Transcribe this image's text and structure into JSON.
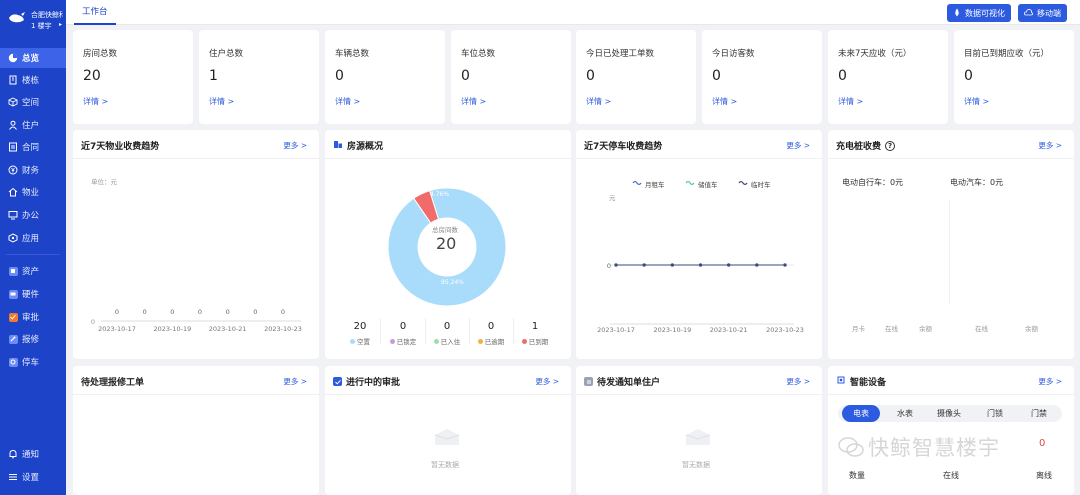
{
  "brand": {
    "company": "合肥快鲸科",
    "building": "1 楼宇",
    "caret": "▸"
  },
  "nav": {
    "overview": "总览",
    "building": "楼栋",
    "space": "空间",
    "resident": "住户",
    "contract": "合同",
    "finance": "财务",
    "property": "物业",
    "office": "办公",
    "apps": "应用",
    "assets": "资产",
    "hardware": "硬件",
    "approval": "审批",
    "repair": "报修",
    "parking": "停车",
    "notify": "通知",
    "settings": "设置"
  },
  "topbar": {
    "tab": "工作台",
    "data_viz": "数据可视化",
    "mobile": "移动端"
  },
  "stats": [
    {
      "title": "房间总数",
      "value": "20",
      "link": "详情 >"
    },
    {
      "title": "住户总数",
      "value": "1",
      "link": "详情 >"
    },
    {
      "title": "车辆总数",
      "value": "0",
      "link": "详情 >"
    },
    {
      "title": "车位总数",
      "value": "0",
      "link": "详情 >"
    },
    {
      "title": "今日已处理工单数",
      "value": "0",
      "link": "详情 >"
    },
    {
      "title": "今日访客数",
      "value": "0",
      "link": "详情 >"
    },
    {
      "title": "未来7天应收（元）",
      "value": "0",
      "link": "详情 >"
    },
    {
      "title": "目前已到期应收（元）",
      "value": "0",
      "link": "详情 >"
    }
  ],
  "panels": {
    "fee_trend": {
      "title": "近7天物业收费趋势",
      "more": "更多 >",
      "unit": "单位：元"
    },
    "housing": {
      "title": "房源概况",
      "center_label": "总房间数",
      "center_value": "20",
      "pct_small": "4.76%",
      "pct_large": "95.24%"
    },
    "parking_trend": {
      "title": "近7天停车收费趋势",
      "more": "更多 >",
      "legend": [
        "月租车",
        "储值车",
        "临时车"
      ],
      "unit_yuan": "元"
    },
    "charging": {
      "title": "充电桩收费",
      "help": "?",
      "more": "更多 >",
      "bike": "电动自行车：0元",
      "car": "电动汽车：0元",
      "axis": [
        "月卡",
        "在线",
        "余额",
        "在线",
        "余额"
      ]
    },
    "repairs": {
      "title": "待处理报修工单",
      "more": "更多 >"
    },
    "approvals": {
      "title": "进行中的审批",
      "more": "更多 >",
      "empty": "暂无数据"
    },
    "notices": {
      "title": "待发通知单住户",
      "more": "更多 >",
      "empty": "暂无数据"
    },
    "devices": {
      "title": "智能设备",
      "more": "更多 >",
      "tabs": [
        "电表",
        "水表",
        "摄像头",
        "门锁",
        "门禁"
      ],
      "cols": [
        "数量",
        "在线",
        "离线"
      ],
      "count": "0"
    }
  },
  "housing_stats": [
    {
      "value": "20",
      "label": "空置",
      "color": "#a9dcfb"
    },
    {
      "value": "0",
      "label": "已锁定",
      "color": "#c79be0"
    },
    {
      "value": "0",
      "label": "已入住",
      "color": "#9be0a8"
    },
    {
      "value": "0",
      "label": "已逾期",
      "color": "#f5b041"
    },
    {
      "value": "1",
      "label": "已到期",
      "color": "#f26b6b"
    }
  ],
  "watermark": "快鲸智慧楼宇",
  "chart_data": [
    {
      "type": "line",
      "title": "近7天物业收费趋势",
      "ylabel": "单位：元",
      "x": [
        "2023-10-17",
        "2023-10-18",
        "2023-10-19",
        "2023-10-20",
        "2023-10-21",
        "2023-10-22",
        "2023-10-23"
      ],
      "x_tick_labels": [
        "2023-10-17",
        "2023-10-19",
        "2023-10-21",
        "2023-10-23"
      ],
      "series": [
        {
          "values": [
            0,
            0,
            0,
            0,
            0,
            0,
            0
          ]
        }
      ],
      "y_tick_labels": [
        "0"
      ]
    },
    {
      "type": "pie",
      "title": "房源概况",
      "labels": [
        "空置",
        "已到期"
      ],
      "values": [
        95.24,
        4.76
      ],
      "colors": [
        "#a9dcfb",
        "#f26b6b"
      ]
    },
    {
      "type": "line",
      "title": "近7天停车收费趋势",
      "x": [
        "2023-10-17",
        "2023-10-18",
        "2023-10-19",
        "2023-10-20",
        "2023-10-21",
        "2023-10-22",
        "2023-10-23"
      ],
      "x_tick_labels": [
        "2023-10-17",
        "2023-10-19",
        "2023-10-21",
        "2023-10-23"
      ],
      "series": [
        {
          "name": "月租车",
          "values": [
            0,
            0,
            0,
            0,
            0,
            0,
            0
          ]
        },
        {
          "name": "储值车",
          "values": [
            0,
            0,
            0,
            0,
            0,
            0,
            0
          ]
        },
        {
          "name": "临时车",
          "values": [
            0,
            0,
            0,
            0,
            0,
            0,
            0
          ]
        }
      ],
      "y_tick_labels": [
        "0"
      ]
    }
  ]
}
